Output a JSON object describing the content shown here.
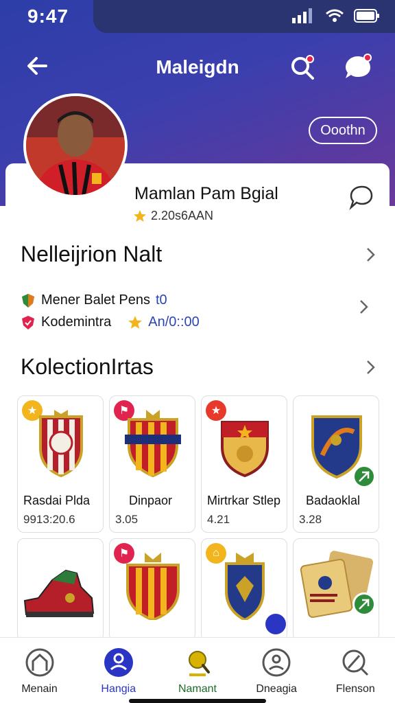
{
  "status": {
    "time": "9:47"
  },
  "header": {
    "title": "Maleigdn",
    "follow_label": "Ooothn"
  },
  "profile": {
    "name": "Mamlan Pam Bgial",
    "rating": "2.20s6AAN"
  },
  "sections": {
    "first": {
      "title": "Nelleijrion Nalt"
    },
    "stats": [
      {
        "label": "Mener Balet Pens",
        "extra": "t0"
      },
      {
        "label": "Kodemintra",
        "extra": "An/0::00"
      }
    ],
    "collections": {
      "title": "KolectionIrtas"
    }
  },
  "tiles": [
    {
      "name": "Rasdai Plda",
      "value": "9913:20.6",
      "badge_icon": "star-icon",
      "badge_color": "#f2b51d"
    },
    {
      "name": "Dinpaor",
      "value": "3.05",
      "badge_icon": "flag-icon",
      "badge_color": "#e0244f"
    },
    {
      "name": "Mirtrkar Stlep",
      "value": "4.21",
      "badge_icon": "star-icon",
      "badge_color": "#e83a2a"
    },
    {
      "name": "Badaoklal",
      "value": "3.28",
      "badge_icon": "none"
    },
    {
      "name": "",
      "value": "",
      "badge_icon": "none"
    },
    {
      "name": "",
      "value": "",
      "badge_icon": "flag-icon",
      "badge_color": "#e0244f"
    },
    {
      "name": "",
      "value": "",
      "badge_icon": "home-icon",
      "badge_color": "#f2b51d"
    },
    {
      "name": "",
      "value": "",
      "badge_icon": "none"
    }
  ],
  "nav": [
    {
      "label": "Menain",
      "icon": "home-icon"
    },
    {
      "label": "Hangia",
      "icon": "profile-icon"
    },
    {
      "label": "Namant",
      "icon": "trophy-icon"
    },
    {
      "label": "Dneagia",
      "icon": "squad-icon"
    },
    {
      "label": "Flenson",
      "icon": "search-icon"
    }
  ],
  "colors": {
    "header_start": "#2d3ea8",
    "header_end": "#6a3a9a",
    "accent_blue": "#2a45b8",
    "accent_green": "#2e8b3a",
    "accent_red": "#e0244f"
  }
}
